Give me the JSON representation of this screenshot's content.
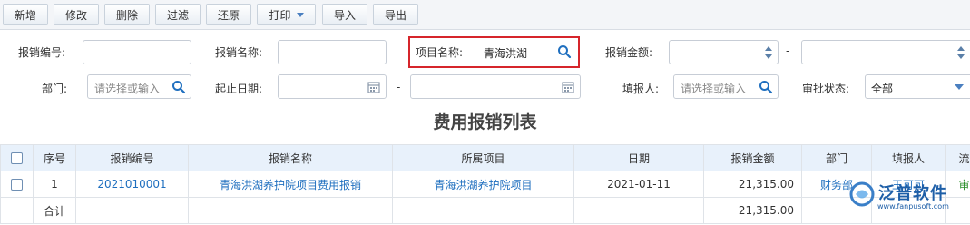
{
  "toolbar": {
    "buttons": [
      {
        "label": "新增"
      },
      {
        "label": "修改"
      },
      {
        "label": "删除"
      },
      {
        "label": "过滤"
      },
      {
        "label": "还原"
      },
      {
        "label": "打印"
      },
      {
        "label": "导入"
      },
      {
        "label": "导出"
      }
    ]
  },
  "filters": {
    "reimb_no_label": "报销编号:",
    "reimb_name_label": "报销名称:",
    "project_name_label": "项目名称:",
    "project_name_value": "青海洪湖",
    "amount_label": "报销金额:",
    "range_dash": "-",
    "dept_label": "部门:",
    "dept_placeholder": "请选择或输入",
    "date_label": "起止日期:",
    "date_dash": "-",
    "filler_label": "填报人:",
    "filler_placeholder": "请选择或输入",
    "approval_label": "审批状态:",
    "approval_value": "全部"
  },
  "list_title": "费用报销列表",
  "table": {
    "headers": [
      "序号",
      "报销编号",
      "报销名称",
      "所属项目",
      "日期",
      "报销金额",
      "部门",
      "填报人",
      "流程状态"
    ],
    "rows": [
      {
        "seq": "1",
        "no": "2021010001",
        "name": "青海洪湖养护院项目费用报销",
        "project": "青海洪湖养护院项目",
        "date": "2021-01-11",
        "amount": "21,315.00",
        "dept": "财务部",
        "filler": "王可可",
        "status": "审批通过"
      }
    ],
    "total_label": "合计",
    "total_amount": "21,315.00"
  },
  "logo": {
    "text": "泛普软件",
    "url": "www.fanpusoft.com"
  },
  "colors": {
    "accent": "#1f6fbf",
    "highlight": "#d6252b",
    "header_bg": "#e8f1fb",
    "status_green": "#2a8f2a"
  }
}
